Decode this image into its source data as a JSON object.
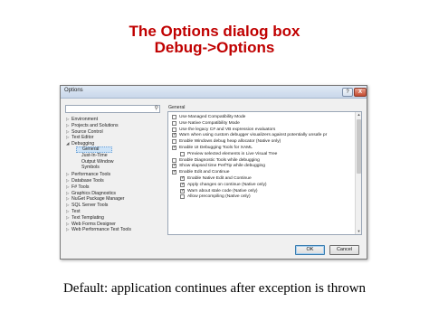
{
  "slide": {
    "title_line1": "The Options dialog box",
    "title_line2": "Debug->Options",
    "caption": "Default: application continues after exception is thrown"
  },
  "dialog": {
    "title": "Options",
    "help_button": "?",
    "close_button": "X",
    "search": {
      "value": "",
      "icon": "search-icon"
    },
    "section_label": "General",
    "tree": [
      {
        "label": "Environment",
        "arrow": "▷",
        "level": 0
      },
      {
        "label": "Projects and Solutions",
        "arrow": "▷",
        "level": 0
      },
      {
        "label": "Source Control",
        "arrow": "▷",
        "level": 0
      },
      {
        "label": "Text Editor",
        "arrow": "▷",
        "level": 0
      },
      {
        "label": "Debugging",
        "arrow": "◢",
        "level": 0
      },
      {
        "label": "General",
        "arrow": "",
        "level": 1,
        "selected": true
      },
      {
        "label": "Just-In-Time",
        "arrow": "",
        "level": 1
      },
      {
        "label": "Output Window",
        "arrow": "",
        "level": 1
      },
      {
        "label": "Symbols",
        "arrow": "",
        "level": 1
      },
      {
        "label": "Performance Tools",
        "arrow": "▷",
        "level": 0
      },
      {
        "label": "Database Tools",
        "arrow": "▷",
        "level": 0
      },
      {
        "label": "F# Tools",
        "arrow": "▷",
        "level": 0
      },
      {
        "label": "Graphics Diagnostics",
        "arrow": "▷",
        "level": 0
      },
      {
        "label": "NuGet Package Manager",
        "arrow": "▷",
        "level": 0
      },
      {
        "label": "SQL Server Tools",
        "arrow": "▷",
        "level": 0
      },
      {
        "label": "Test",
        "arrow": "▷",
        "level": 0
      },
      {
        "label": "Text Templating",
        "arrow": "▷",
        "level": 0
      },
      {
        "label": "Web Forms Designer",
        "arrow": "▷",
        "level": 0
      },
      {
        "label": "Web Performance Test Tools",
        "arrow": "▷",
        "level": 0
      }
    ],
    "options": [
      {
        "label": "Use Managed Compatibility Mode",
        "checked": false,
        "indent": 0
      },
      {
        "label": "Use Native Compatibility Mode",
        "checked": false,
        "indent": 0
      },
      {
        "label": "Use the legacy C# and VB expression evaluators",
        "checked": false,
        "indent": 0
      },
      {
        "label": "Warn when using custom debugger visualizers against potentially unsafe pr",
        "checked": true,
        "indent": 0
      },
      {
        "label": "Enable Windows debug heap allocator (Native only)",
        "checked": false,
        "indent": 0
      },
      {
        "label": "Enable UI Debugging Tools for XAML",
        "checked": true,
        "indent": 0
      },
      {
        "label": "Preview selected elements in Live Visual Tree",
        "checked": false,
        "indent": 1
      },
      {
        "label": "Enable Diagnostic Tools while debugging",
        "checked": false,
        "indent": 0
      },
      {
        "label": "Show elapsed time PerfTip while debugging",
        "checked": true,
        "indent": 0
      },
      {
        "label": "Enable Edit and Continue",
        "checked": true,
        "indent": 0
      },
      {
        "label": "Enable Native Edit and Continue",
        "checked": true,
        "indent": 1
      },
      {
        "label": "Apply changes on continue (Native only)",
        "checked": true,
        "indent": 1
      },
      {
        "label": "Warn about stale code (Native only)",
        "checked": true,
        "indent": 1
      },
      {
        "label": "Allow precompiling (Native only)",
        "checked": false,
        "indent": 1
      }
    ],
    "ok_label": "OK",
    "cancel_label": "Cancel"
  }
}
